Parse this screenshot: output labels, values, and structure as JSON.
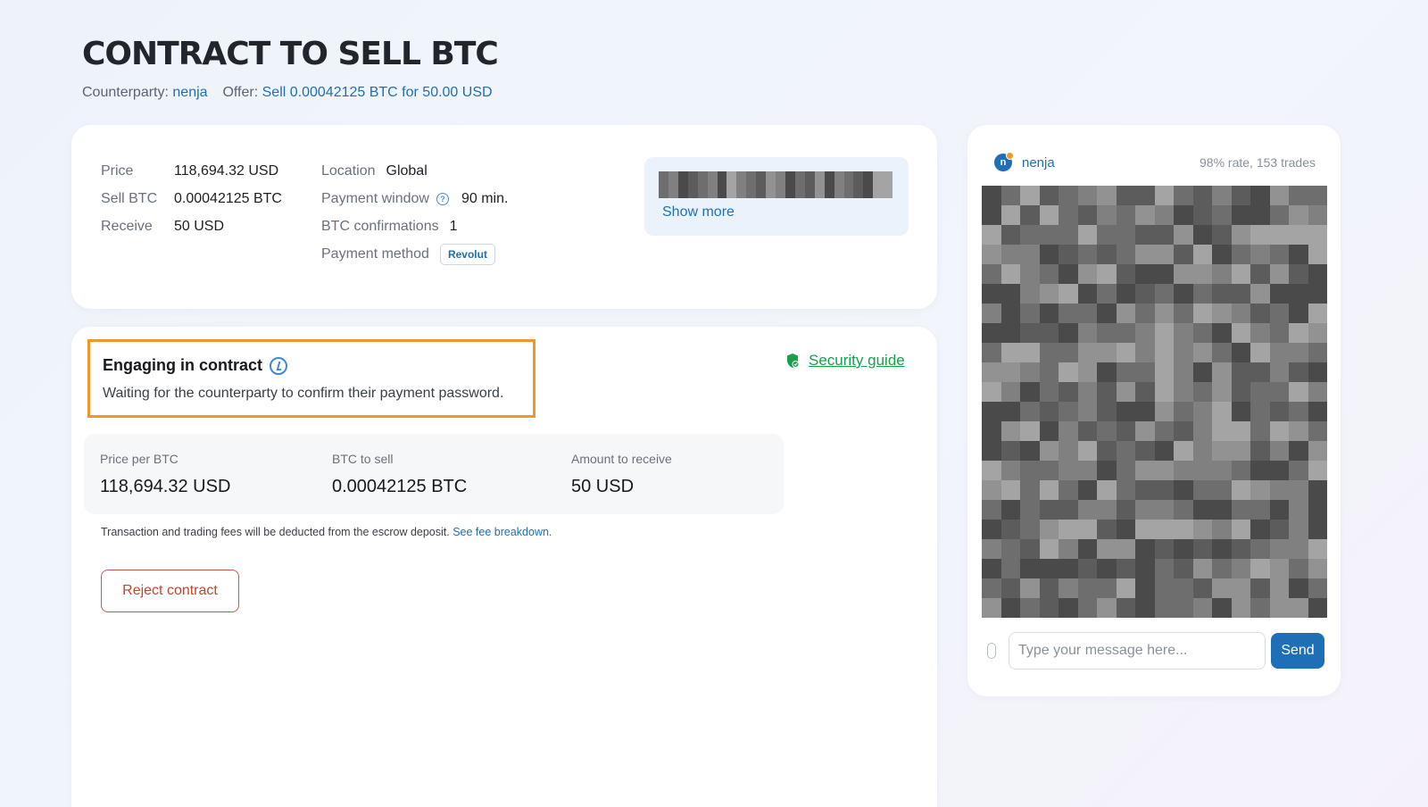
{
  "header": {
    "title": "CONTRACT TO SELL BTC",
    "counterparty_label": "Counterparty:",
    "counterparty_name": "nenja",
    "offer_label": "Offer:",
    "offer_text": "Sell 0.00042125 BTC for 50.00 USD"
  },
  "details": {
    "left": [
      {
        "label": "Price",
        "value": "118,694.32 USD"
      },
      {
        "label": "Sell BTC",
        "value": "0.00042125 BTC"
      },
      {
        "label": "Receive",
        "value": "50 USD"
      }
    ],
    "location": {
      "label": "Location",
      "value": "Global"
    },
    "payment_window": {
      "label": "Payment window",
      "value": "90 min."
    },
    "confirmations": {
      "label": "BTC confirmations",
      "value": "1"
    },
    "payment_method": {
      "label": "Payment method",
      "value": "Revolut"
    },
    "show_more": "Show more"
  },
  "status": {
    "title": "Engaging in contract",
    "description": "Waiting for the counterparty to confirm their payment password.",
    "security_guide": "Security guide"
  },
  "summary": [
    {
      "label": "Price per BTC",
      "value": "118,694.32 USD"
    },
    {
      "label": "BTC to sell",
      "value": "0.00042125 BTC"
    },
    {
      "label": "Amount to receive",
      "value": "50 USD"
    }
  ],
  "fee_note": {
    "text": "Transaction and trading fees will be deducted from the escrow deposit.",
    "link": "See fee breakdown."
  },
  "actions": {
    "reject": "Reject contract"
  },
  "chat": {
    "avatar_initial": "n",
    "username": "nenja",
    "rating": "98% rate, 153 trades",
    "placeholder": "Type your message here...",
    "send": "Send"
  },
  "colors": {
    "accent": "#1f6fb8",
    "highlight_border": "#f0962a",
    "security_green": "#18a04b",
    "reject_red": "#c0462f"
  }
}
